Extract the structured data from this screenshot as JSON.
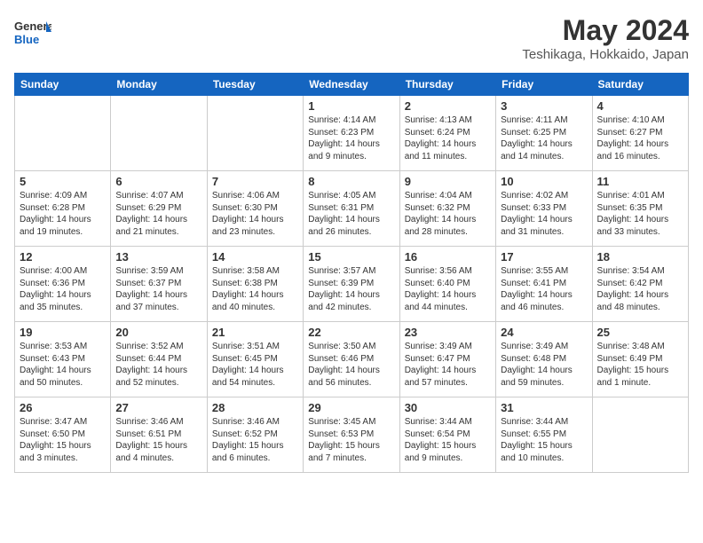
{
  "header": {
    "logo_general": "General",
    "logo_blue": "Blue",
    "month_title": "May 2024",
    "location": "Teshikaga, Hokkaido, Japan"
  },
  "weekdays": [
    "Sunday",
    "Monday",
    "Tuesday",
    "Wednesday",
    "Thursday",
    "Friday",
    "Saturday"
  ],
  "weeks": [
    [
      {
        "day": "",
        "info": ""
      },
      {
        "day": "",
        "info": ""
      },
      {
        "day": "",
        "info": ""
      },
      {
        "day": "1",
        "info": "Sunrise: 4:14 AM\nSunset: 6:23 PM\nDaylight: 14 hours\nand 9 minutes."
      },
      {
        "day": "2",
        "info": "Sunrise: 4:13 AM\nSunset: 6:24 PM\nDaylight: 14 hours\nand 11 minutes."
      },
      {
        "day": "3",
        "info": "Sunrise: 4:11 AM\nSunset: 6:25 PM\nDaylight: 14 hours\nand 14 minutes."
      },
      {
        "day": "4",
        "info": "Sunrise: 4:10 AM\nSunset: 6:27 PM\nDaylight: 14 hours\nand 16 minutes."
      }
    ],
    [
      {
        "day": "5",
        "info": "Sunrise: 4:09 AM\nSunset: 6:28 PM\nDaylight: 14 hours\nand 19 minutes."
      },
      {
        "day": "6",
        "info": "Sunrise: 4:07 AM\nSunset: 6:29 PM\nDaylight: 14 hours\nand 21 minutes."
      },
      {
        "day": "7",
        "info": "Sunrise: 4:06 AM\nSunset: 6:30 PM\nDaylight: 14 hours\nand 23 minutes."
      },
      {
        "day": "8",
        "info": "Sunrise: 4:05 AM\nSunset: 6:31 PM\nDaylight: 14 hours\nand 26 minutes."
      },
      {
        "day": "9",
        "info": "Sunrise: 4:04 AM\nSunset: 6:32 PM\nDaylight: 14 hours\nand 28 minutes."
      },
      {
        "day": "10",
        "info": "Sunrise: 4:02 AM\nSunset: 6:33 PM\nDaylight: 14 hours\nand 31 minutes."
      },
      {
        "day": "11",
        "info": "Sunrise: 4:01 AM\nSunset: 6:35 PM\nDaylight: 14 hours\nand 33 minutes."
      }
    ],
    [
      {
        "day": "12",
        "info": "Sunrise: 4:00 AM\nSunset: 6:36 PM\nDaylight: 14 hours\nand 35 minutes."
      },
      {
        "day": "13",
        "info": "Sunrise: 3:59 AM\nSunset: 6:37 PM\nDaylight: 14 hours\nand 37 minutes."
      },
      {
        "day": "14",
        "info": "Sunrise: 3:58 AM\nSunset: 6:38 PM\nDaylight: 14 hours\nand 40 minutes."
      },
      {
        "day": "15",
        "info": "Sunrise: 3:57 AM\nSunset: 6:39 PM\nDaylight: 14 hours\nand 42 minutes."
      },
      {
        "day": "16",
        "info": "Sunrise: 3:56 AM\nSunset: 6:40 PM\nDaylight: 14 hours\nand 44 minutes."
      },
      {
        "day": "17",
        "info": "Sunrise: 3:55 AM\nSunset: 6:41 PM\nDaylight: 14 hours\nand 46 minutes."
      },
      {
        "day": "18",
        "info": "Sunrise: 3:54 AM\nSunset: 6:42 PM\nDaylight: 14 hours\nand 48 minutes."
      }
    ],
    [
      {
        "day": "19",
        "info": "Sunrise: 3:53 AM\nSunset: 6:43 PM\nDaylight: 14 hours\nand 50 minutes."
      },
      {
        "day": "20",
        "info": "Sunrise: 3:52 AM\nSunset: 6:44 PM\nDaylight: 14 hours\nand 52 minutes."
      },
      {
        "day": "21",
        "info": "Sunrise: 3:51 AM\nSunset: 6:45 PM\nDaylight: 14 hours\nand 54 minutes."
      },
      {
        "day": "22",
        "info": "Sunrise: 3:50 AM\nSunset: 6:46 PM\nDaylight: 14 hours\nand 56 minutes."
      },
      {
        "day": "23",
        "info": "Sunrise: 3:49 AM\nSunset: 6:47 PM\nDaylight: 14 hours\nand 57 minutes."
      },
      {
        "day": "24",
        "info": "Sunrise: 3:49 AM\nSunset: 6:48 PM\nDaylight: 14 hours\nand 59 minutes."
      },
      {
        "day": "25",
        "info": "Sunrise: 3:48 AM\nSunset: 6:49 PM\nDaylight: 15 hours\nand 1 minute."
      }
    ],
    [
      {
        "day": "26",
        "info": "Sunrise: 3:47 AM\nSunset: 6:50 PM\nDaylight: 15 hours\nand 3 minutes."
      },
      {
        "day": "27",
        "info": "Sunrise: 3:46 AM\nSunset: 6:51 PM\nDaylight: 15 hours\nand 4 minutes."
      },
      {
        "day": "28",
        "info": "Sunrise: 3:46 AM\nSunset: 6:52 PM\nDaylight: 15 hours\nand 6 minutes."
      },
      {
        "day": "29",
        "info": "Sunrise: 3:45 AM\nSunset: 6:53 PM\nDaylight: 15 hours\nand 7 minutes."
      },
      {
        "day": "30",
        "info": "Sunrise: 3:44 AM\nSunset: 6:54 PM\nDaylight: 15 hours\nand 9 minutes."
      },
      {
        "day": "31",
        "info": "Sunrise: 3:44 AM\nSunset: 6:55 PM\nDaylight: 15 hours\nand 10 minutes."
      },
      {
        "day": "",
        "info": ""
      }
    ]
  ]
}
